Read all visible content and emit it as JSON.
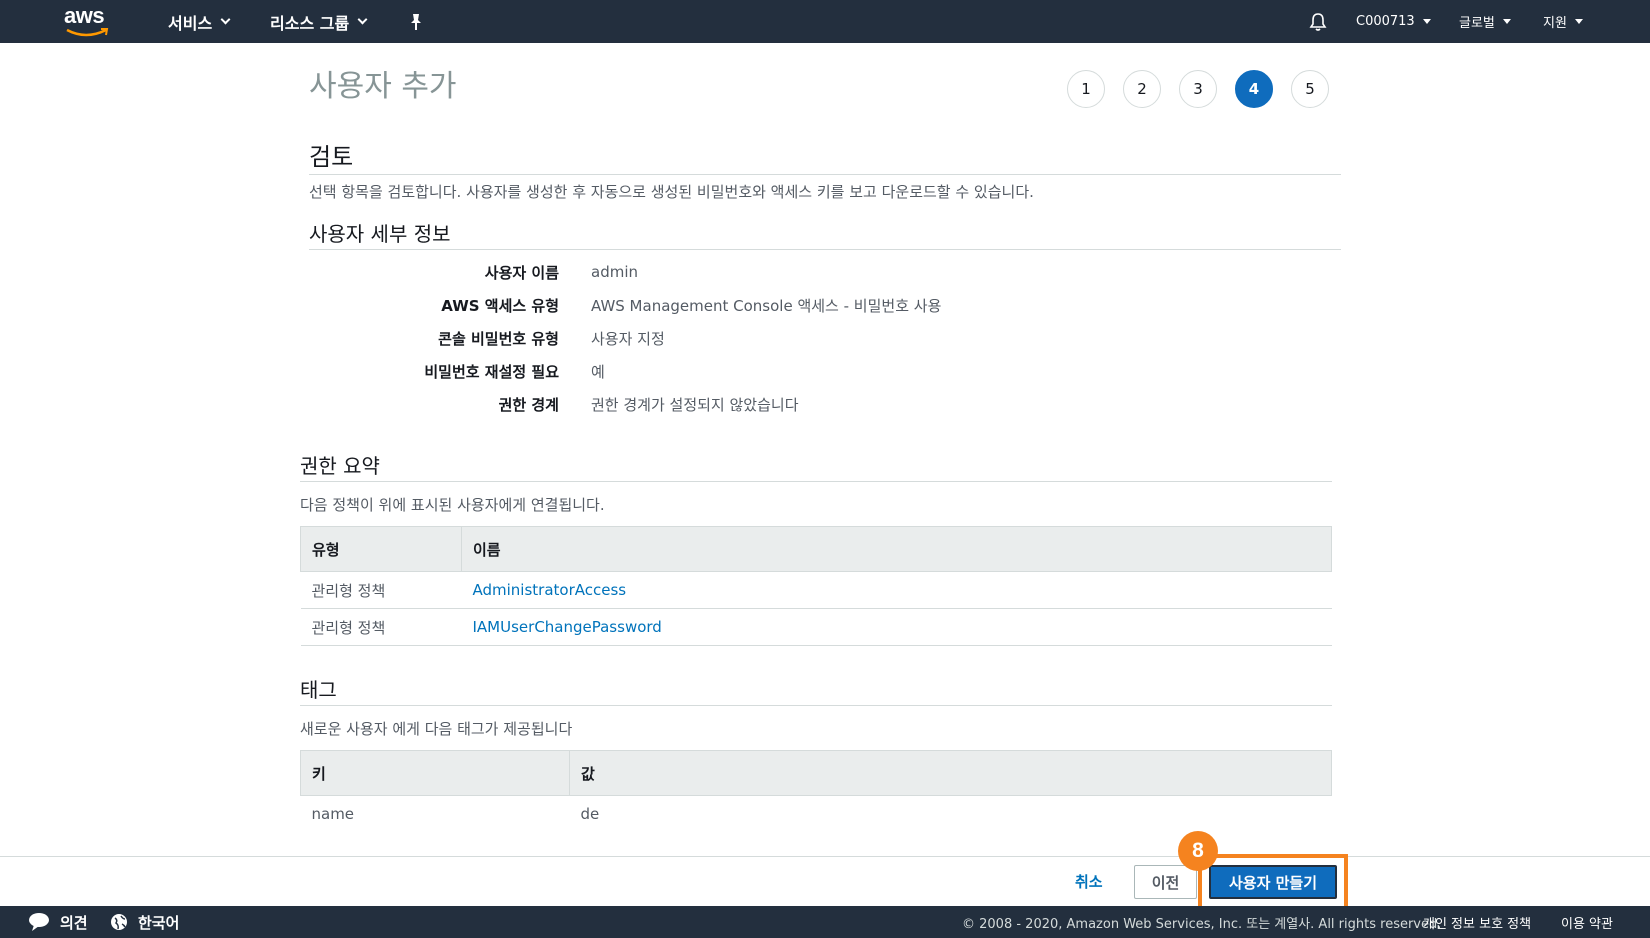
{
  "nav": {
    "logo_text": "aws",
    "services": "서비스",
    "resource_groups": "리소스 그룹",
    "pin_icon": "pin-icon",
    "bell_icon": "bell-icon",
    "account": "C000713",
    "region": "글로벌",
    "support": "지원"
  },
  "page": {
    "title": "사용자 추가",
    "steps": [
      "1",
      "2",
      "3",
      "4",
      "5"
    ],
    "active_step": "4"
  },
  "review": {
    "heading": "검토",
    "description": "선택 항목을 검토합니다. 사용자를 생성한 후 자동으로 생성된 비밀번호와 액세스 키를 보고 다운로드할 수 있습니다."
  },
  "details": {
    "heading": "사용자 세부 정보",
    "rows": [
      {
        "label": "사용자 이름",
        "value": "admin"
      },
      {
        "label": "AWS 액세스 유형",
        "value": "AWS Management Console 액세스 - 비밀번호 사용"
      },
      {
        "label": "콘솔 비밀번호 유형",
        "value": "사용자 지정"
      },
      {
        "label": "비밀번호 재설정 필요",
        "value": "예"
      },
      {
        "label": "권한 경계",
        "value": "권한 경계가 설정되지 않았습니다"
      }
    ]
  },
  "permissions": {
    "heading": "권한 요약",
    "description": "다음 정책이 위에 표시된 사용자에게 연결됩니다.",
    "columns": [
      "유형",
      "이름"
    ],
    "rows": [
      {
        "type": "관리형 정책",
        "name": "AdministratorAccess"
      },
      {
        "type": "관리형 정책",
        "name": "IAMUserChangePassword"
      }
    ]
  },
  "tags": {
    "heading": "태그",
    "description": "새로운 사용자 에게 다음 태그가 제공됩니다",
    "columns": [
      "키",
      "값"
    ],
    "rows": [
      {
        "key": "name",
        "value": "de"
      }
    ]
  },
  "actions": {
    "cancel": "취소",
    "previous": "이전",
    "create": "사용자 만들기",
    "callout_number": "8"
  },
  "footer": {
    "feedback": "의견",
    "language": "한국어",
    "copyright": "© 2008 - 2020, Amazon Web Services, Inc. 또는 계열사. All rights reserved.",
    "privacy": "개인 정보 보호 정책",
    "terms": "이용 약관"
  },
  "colors": {
    "nav_bg": "#232f3e",
    "primary": "#0f6cbd",
    "link": "#0073bb",
    "highlight": "#f5831f"
  }
}
